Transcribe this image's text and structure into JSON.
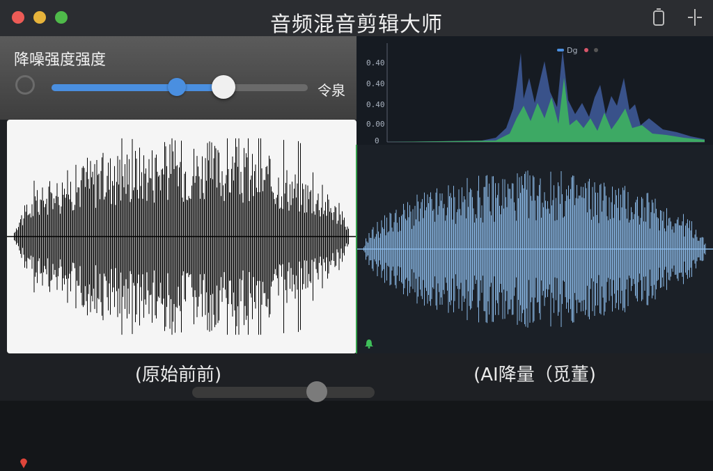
{
  "window": {
    "title": "音频混音剪辑大师",
    "icons": [
      "close-icon",
      "minimize-icon",
      "maximize-icon",
      "phone-icon",
      "split-icon"
    ]
  },
  "controls": {
    "noise_label": "降噪强度强度",
    "slider_value_text": "令泉",
    "slider_blue_fraction": 0.49,
    "slider_white_fraction": 0.67
  },
  "spectrum": {
    "legend": "Dg",
    "y_ticks": [
      "0.40",
      "0.40",
      "0.40",
      "0.00",
      "0"
    ],
    "colors": {
      "series_a": "#3f5c9c",
      "series_b": "#3fbf5a",
      "legend_dot_blue": "#4a8fe0",
      "legend_dot_red": "#d8566a"
    }
  },
  "waveforms": {
    "left_caption": "(原始前前)",
    "right_caption": "(AI降量（觅董)",
    "left_color": "#000000",
    "right_color": "#8ab8e6"
  }
}
